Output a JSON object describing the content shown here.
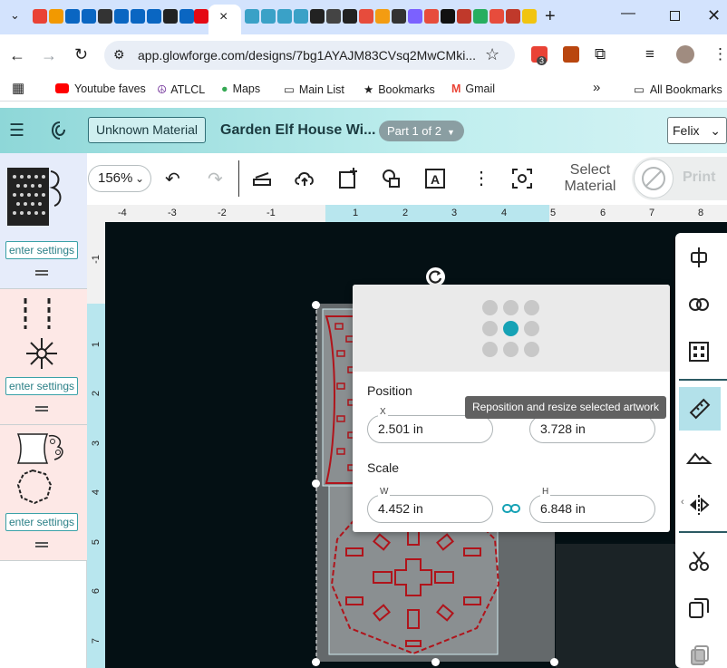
{
  "browser": {
    "active_tab_close": "×",
    "new_tab": "+",
    "url": "app.glowforge.com/designs/7bg1AYAJM83CVsq2MwCMki...",
    "extension_badge": "3",
    "bookmarks": [
      "Youtube faves",
      "ATLCL",
      "Maps",
      "Main List",
      "Bookmarks",
      "Gmail"
    ],
    "all_bookmarks": "All Bookmarks",
    "more": "»"
  },
  "app": {
    "material_button": "Unknown Material",
    "design_title": "Garden Elf House Wi...",
    "part_pill": "Part 1 of 2",
    "user": "Felix"
  },
  "sidebar": {
    "items": [
      {
        "settings_label": "enter settings",
        "highlight": "#e6ecfa"
      },
      {
        "settings_label": "enter settings",
        "highlight": "#fde8e6"
      },
      {
        "settings_label": "enter settings",
        "highlight": "#fde8e6"
      }
    ]
  },
  "toolbar": {
    "zoom": "156%",
    "select_material": "Select Material",
    "print": "Print"
  },
  "rulers": {
    "horizontal": [
      "-4",
      "-3",
      "-2",
      "-1",
      "1",
      "2",
      "3",
      "4",
      "5",
      "6",
      "7",
      "8"
    ],
    "vertical": [
      "-1",
      "1",
      "2",
      "3",
      "4",
      "5",
      "6",
      "7"
    ]
  },
  "popover": {
    "position_label": "Position",
    "x_label": "X",
    "x_value": "2.501 in",
    "y_value": "3.728 in",
    "scale_label": "Scale",
    "w_label": "W",
    "w_value": "4.452 in",
    "h_label": "H",
    "h_value": "6.848 in",
    "tooltip": "Reposition and resize selected artwork"
  },
  "colors": {
    "accent": "#16a2b5",
    "cut_red": "#b0141b",
    "canvas": "#041014"
  }
}
